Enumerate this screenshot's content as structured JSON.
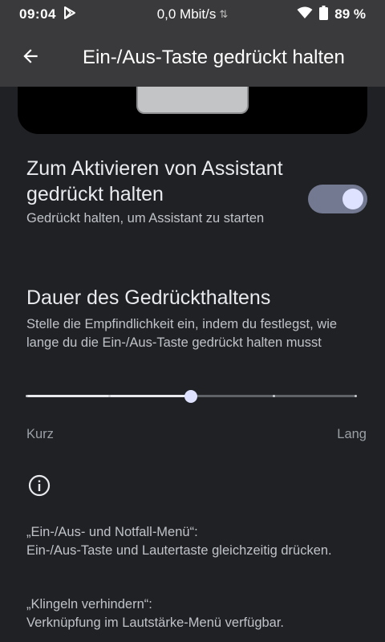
{
  "status_bar": {
    "time": "09:04",
    "network_speed": "0,0 Mbit/s",
    "battery_percent": "89 %"
  },
  "app_bar": {
    "title": "Ein-/Aus-Taste gedrückt halten"
  },
  "assistant_toggle": {
    "title": "Zum Aktivieren von Assistant gedrückt halten",
    "summary": "Gedrückt halten, um Assistant zu starten",
    "checked": true
  },
  "duration": {
    "title": "Dauer des Gedrückthaltens",
    "summary": "Stelle die Empfindlichkeit ein, indem du festlegst, wie lange du die Ein-/Aus-Taste gedrückt halten musst",
    "slider": {
      "steps": 5,
      "selected_index": 2,
      "min_label": "Kurz",
      "max_label": "Lang"
    }
  },
  "info": {
    "note1_title": "„Ein-/Aus- und Notfall-Menü“:",
    "note1_body": "Ein-/Aus-Taste und Lautertaste gleichzeitig drücken.",
    "note2_title": "„Klingeln verhindern“:",
    "note2_body": "Verknüpfung im Lautstärke-Menü verfügbar."
  },
  "colors": {
    "bar_background": "#3a3a3c",
    "page_background": "#202124",
    "switch_track": "#727991",
    "accent_thumb": "#dfe2ff"
  },
  "icons": {
    "status_left": "play-store-notification-icon",
    "status_right": [
      "wifi-icon",
      "battery-icon"
    ],
    "back": "arrow-back-icon",
    "info": "info-outline-icon"
  }
}
